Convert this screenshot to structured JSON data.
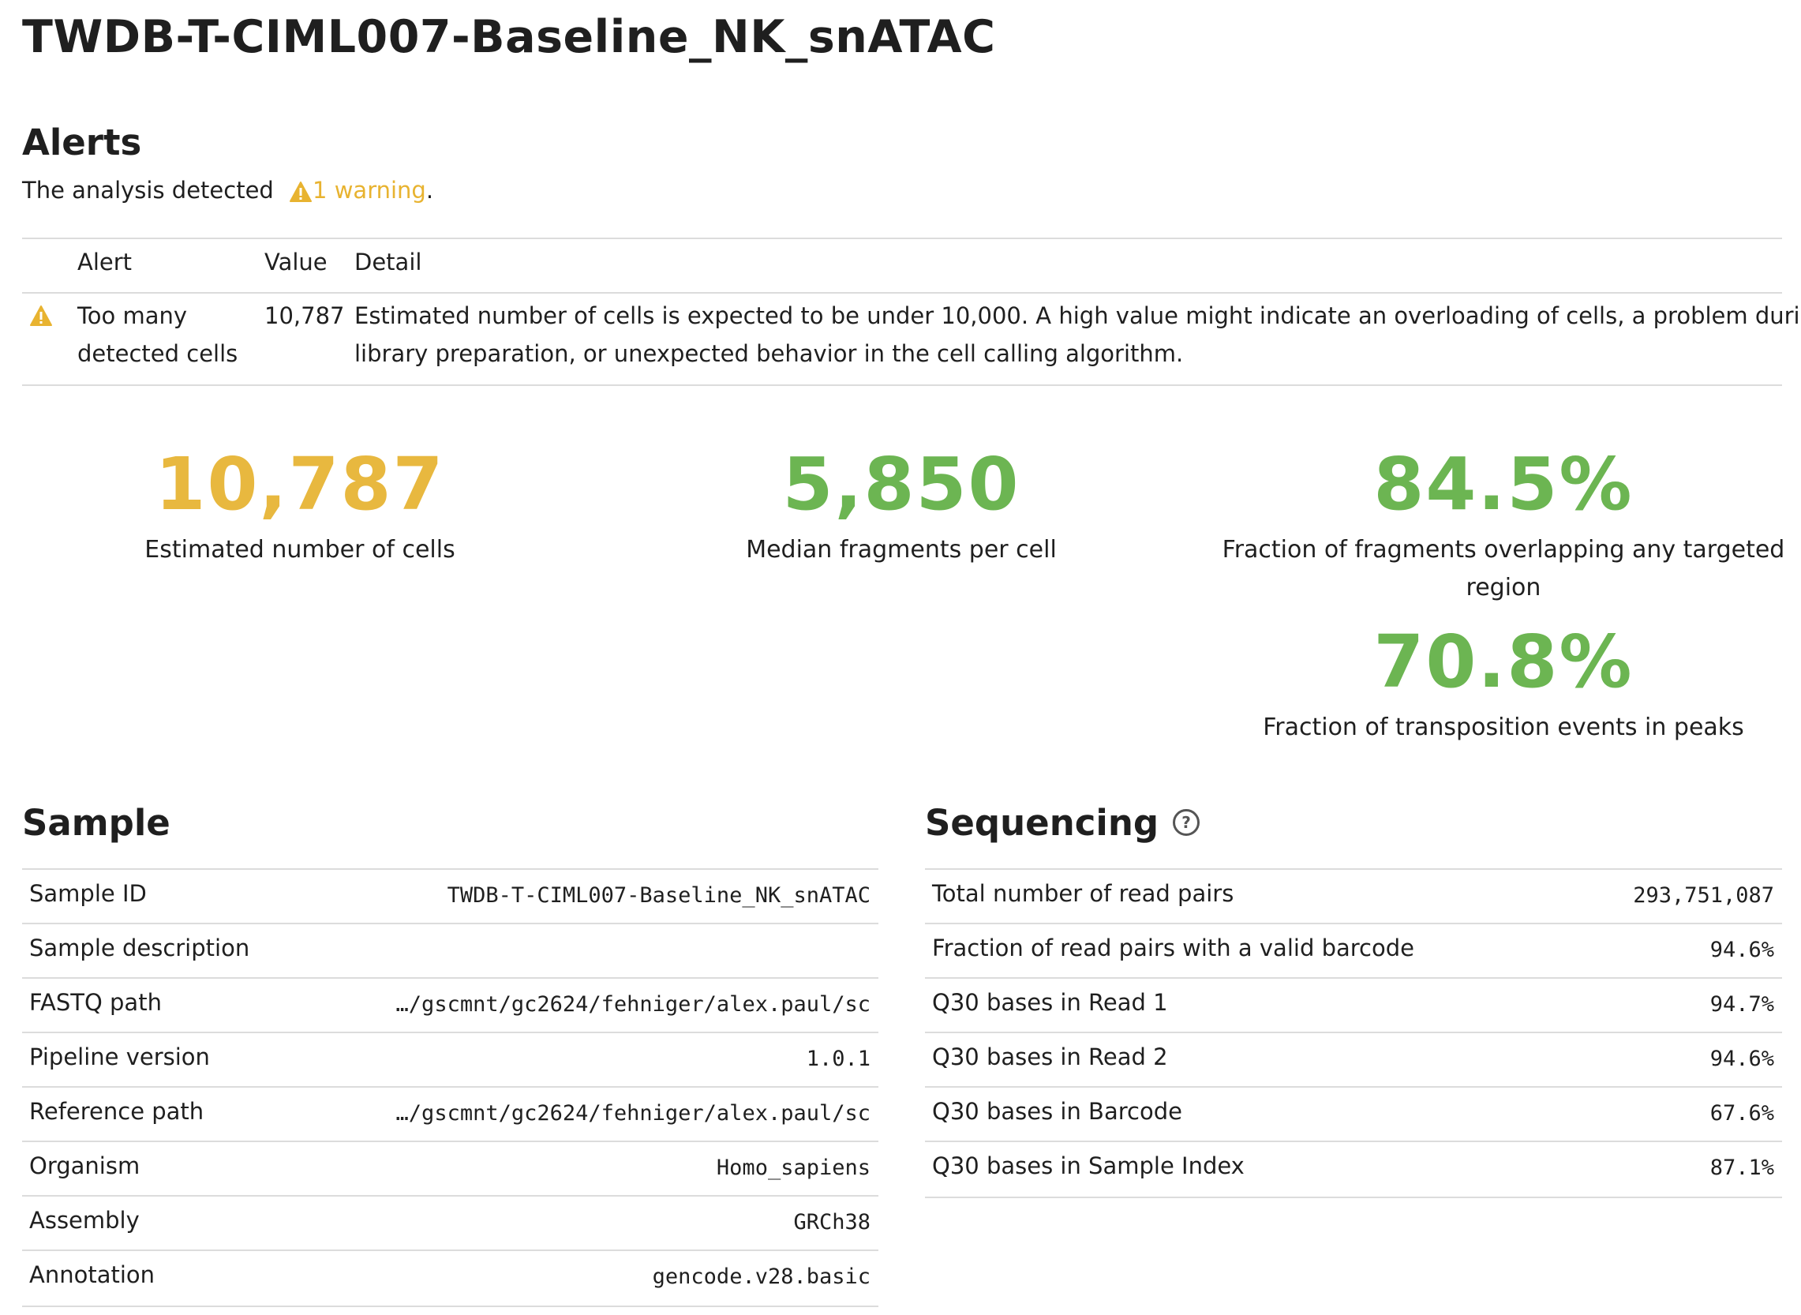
{
  "page_title": "TWDB-T-CIML007-Baseline_NK_snATAC",
  "alerts": {
    "heading": "Alerts",
    "summary_prefix": "The analysis detected",
    "warning_link": "1 warning",
    "summary_suffix": ".",
    "columns": [
      "Alert",
      "Value",
      "Detail"
    ],
    "rows": [
      {
        "alert_line1": "Too many",
        "alert_line2": "detected cells",
        "value": "10,787",
        "detail_line1": "Estimated number of cells is expected to be under 10,000. A high value might indicate an overloading of cells, a problem during",
        "detail_line2": "library preparation, or unexpected behavior in the cell calling algorithm."
      }
    ]
  },
  "metrics": {
    "cells_value": "10,787",
    "cells_label": "Estimated number of cells",
    "median_value": "5,850",
    "median_label": "Median fragments per cell",
    "targeted_value": "84.5%",
    "targeted_label_line1": "Fraction of fragments overlapping any targeted",
    "targeted_label_line2": "region",
    "peaks_value": "70.8%",
    "peaks_label": "Fraction of transposition events in peaks",
    "colors": {
      "warning": "#e8b83f",
      "good": "#6cb552"
    }
  },
  "sample": {
    "heading": "Sample",
    "rows": [
      {
        "label": "Sample ID",
        "value": "TWDB-T-CIML007-Baseline_NK_snATAC"
      },
      {
        "label": "Sample description",
        "value": ""
      },
      {
        "label": "FASTQ path",
        "value": "…/gscmnt/gc2624/fehniger/alex.paul/sc"
      },
      {
        "label": "Pipeline version",
        "value": "1.0.1"
      },
      {
        "label": "Reference path",
        "value": "…/gscmnt/gc2624/fehniger/alex.paul/sc"
      },
      {
        "label": "Organism",
        "value": "Homo_sapiens"
      },
      {
        "label": "Assembly",
        "value": "GRCh38"
      },
      {
        "label": "Annotation",
        "value": "gencode.v28.basic"
      }
    ]
  },
  "sequencing": {
    "heading": "Sequencing",
    "help_icon": "help-circle-icon",
    "rows": [
      {
        "label": "Total number of read pairs",
        "value": "293,751,087"
      },
      {
        "label": "Fraction of read pairs with a valid barcode",
        "value": "94.6%"
      },
      {
        "label": "Q30 bases in Read 1",
        "value": "94.7%"
      },
      {
        "label": "Q30 bases in Read 2",
        "value": "94.6%"
      },
      {
        "label": "Q30 bases in Barcode",
        "value": "67.6%"
      },
      {
        "label": "Q30 bases in Sample Index",
        "value": "87.1%"
      }
    ]
  }
}
